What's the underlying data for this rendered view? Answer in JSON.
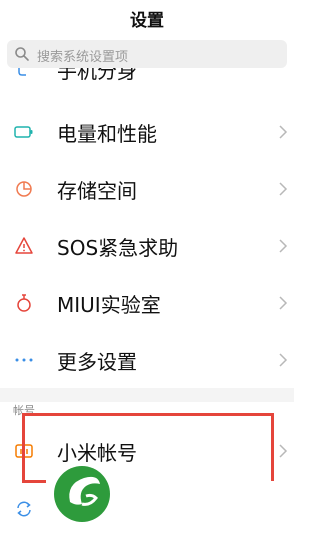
{
  "header": {
    "title": "设置"
  },
  "search": {
    "placeholder": "搜索系统设置项"
  },
  "partial_item": {
    "label": "手机分身"
  },
  "items": [
    {
      "label": "电量和性能",
      "icon": "battery-icon",
      "color": "#1fb3ad"
    },
    {
      "label": "存储空间",
      "icon": "storage-pie-icon",
      "color": "#f07a50"
    },
    {
      "label": "SOS紧急求助",
      "icon": "sos-warning-icon",
      "color": "#e5453b"
    },
    {
      "label": "MIUI实验室",
      "icon": "lab-flask-icon",
      "color": "#e5453b"
    },
    {
      "label": "更多设置",
      "icon": "more-dots-icon",
      "color": "#3a8ee6"
    }
  ],
  "account_section": {
    "header": "帐号",
    "items": [
      {
        "label": "小米帐号",
        "icon": "mi-icon",
        "color": "#f57c00"
      },
      {
        "label": "",
        "icon": "sync-icon",
        "color": "#3a8ee6"
      }
    ]
  },
  "annotation": {
    "color": "#e5453b"
  },
  "watermark": {
    "icon": "leaf-logo-icon",
    "color": "#2e9b3c"
  }
}
